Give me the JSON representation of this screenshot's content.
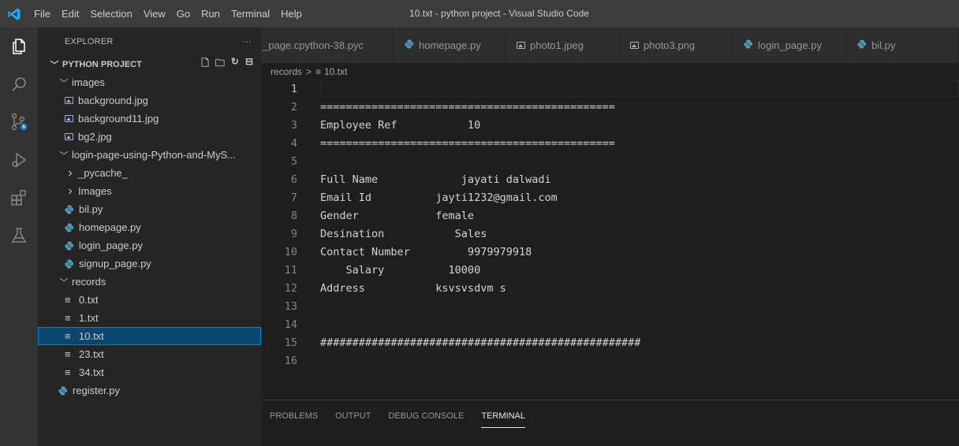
{
  "menu": [
    "File",
    "Edit",
    "Selection",
    "View",
    "Go",
    "Run",
    "Terminal",
    "Help"
  ],
  "window_title": "10.txt - python project - Visual Studio Code",
  "explorer": {
    "header": "EXPLORER",
    "more": "···",
    "project": "PYTHON PROJECT",
    "tree": [
      {
        "label": "images",
        "depth": 1,
        "kind": "folder",
        "open": true
      },
      {
        "label": "background.jpg",
        "depth": 2,
        "kind": "image"
      },
      {
        "label": "background11.jpg",
        "depth": 2,
        "kind": "image"
      },
      {
        "label": "bg2.jpg",
        "depth": 2,
        "kind": "image"
      },
      {
        "label": "login-page-using-Python-and-MyS...",
        "depth": 1,
        "kind": "folder",
        "open": true
      },
      {
        "label": "_pycache_",
        "depth": 2,
        "kind": "folder",
        "open": false
      },
      {
        "label": "Images",
        "depth": 2,
        "kind": "folder",
        "open": false
      },
      {
        "label": "bil.py",
        "depth": 2,
        "kind": "python"
      },
      {
        "label": "homepage.py",
        "depth": 2,
        "kind": "python"
      },
      {
        "label": "login_page.py",
        "depth": 2,
        "kind": "python"
      },
      {
        "label": "signup_page.py",
        "depth": 2,
        "kind": "python"
      },
      {
        "label": "records",
        "depth": 1,
        "kind": "folder",
        "open": true
      },
      {
        "label": "0.txt",
        "depth": 2,
        "kind": "text"
      },
      {
        "label": "1.txt",
        "depth": 2,
        "kind": "text"
      },
      {
        "label": "10.txt",
        "depth": 2,
        "kind": "text",
        "selected": true
      },
      {
        "label": "23.txt",
        "depth": 2,
        "kind": "text"
      },
      {
        "label": "34.txt",
        "depth": 2,
        "kind": "text"
      },
      {
        "label": "register.py",
        "depth": 1,
        "kind": "python"
      }
    ]
  },
  "tabs": [
    {
      "label": "_page.cpython-38.pyc",
      "kind": "none"
    },
    {
      "label": "homepage.py",
      "kind": "python"
    },
    {
      "label": "photo1.jpeg",
      "kind": "image"
    },
    {
      "label": "photo3.png",
      "kind": "image"
    },
    {
      "label": "login_page.py",
      "kind": "python"
    },
    {
      "label": "bil.py",
      "kind": "python"
    }
  ],
  "breadcrumb": {
    "folder": "records",
    "sep": ">",
    "file": "10.txt"
  },
  "editor_lines": [
    {
      "n": "1",
      "text": ""
    },
    {
      "n": "2",
      "text": "=============================================="
    },
    {
      "n": "3",
      "text": "Employee Ref           10"
    },
    {
      "n": "4",
      "text": "=============================================="
    },
    {
      "n": "5",
      "text": ""
    },
    {
      "n": "6",
      "text": "Full Name             jayati dalwadi"
    },
    {
      "n": "7",
      "text": "Email Id          jayti1232@gmail.com"
    },
    {
      "n": "8",
      "text": "Gender            female"
    },
    {
      "n": "9",
      "text": "Desination           Sales"
    },
    {
      "n": "10",
      "text": "Contact Number         9979979918"
    },
    {
      "n": "11",
      "text": "    Salary          10000"
    },
    {
      "n": "12",
      "text": "Address           ksvsvsdvm s"
    },
    {
      "n": "13",
      "text": ""
    },
    {
      "n": "14",
      "text": ""
    },
    {
      "n": "15",
      "text": "##################################################"
    },
    {
      "n": "16",
      "text": ""
    }
  ],
  "panel_tabs": [
    {
      "label": "PROBLEMS",
      "active": false
    },
    {
      "label": "OUTPUT",
      "active": false
    },
    {
      "label": "DEBUG CONSOLE",
      "active": false
    },
    {
      "label": "TERMINAL",
      "active": true
    }
  ],
  "colors": {
    "accent": "#007acc",
    "selection": "#094771",
    "python_icon": "#519aba"
  }
}
